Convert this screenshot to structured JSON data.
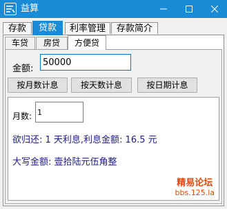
{
  "window": {
    "title": "益算",
    "accent_color": "#1a8bd6",
    "icons": [
      "app-logo-icon",
      "minimize-icon",
      "maximize-icon",
      "close-icon"
    ]
  },
  "outer_tabs": [
    {
      "label": "存款",
      "active": false
    },
    {
      "label": "贷款",
      "active": true
    },
    {
      "label": "利率管理",
      "active": false
    },
    {
      "label": "存款简介",
      "active": false
    }
  ],
  "inner_tabs": [
    {
      "label": "车贷",
      "active": false
    },
    {
      "label": "房贷",
      "active": false
    },
    {
      "label": "方便贷",
      "active": true
    }
  ],
  "amount": {
    "label": "金额:",
    "value": "50000"
  },
  "buttons": {
    "by_month": "按月数计息",
    "by_day": "按天数计息",
    "by_date": "按日期计息"
  },
  "months": {
    "label": "月数:",
    "value": "1"
  },
  "result": {
    "repay_line": "欲归还: 1 天利息,利息金额: 16.5 元",
    "capital_line": "大写金额: 壹拾陆元伍角整",
    "text_color": "#1c1c8a"
  },
  "watermark": {
    "title": "精易论坛",
    "url": "bbs.125.la",
    "color": "#e04a12"
  }
}
